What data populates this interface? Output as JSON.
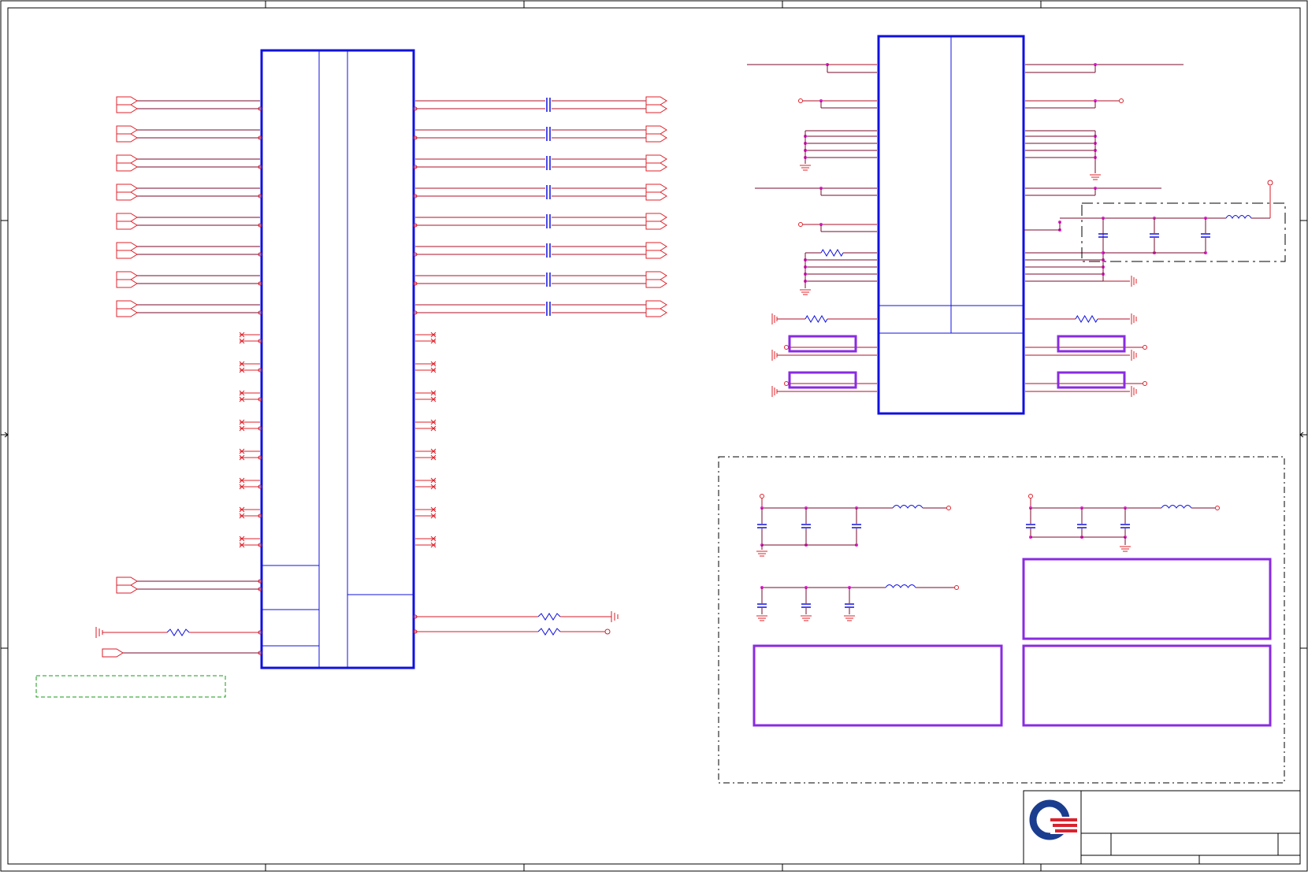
{
  "sheet": {
    "colors": {
      "border": "#000000",
      "wire": "#b0102a",
      "wire_dark": "#7a0b2e",
      "pin": "#e0202a",
      "component": "#1010e0",
      "capacitor": "#1010e0",
      "junction": "#e020d0",
      "highlight_box": "#8a2be2",
      "note_box": "#1a9a1a",
      "dash_box": "#000000"
    },
    "left_chip": {
      "input_port_count": 8,
      "output_port_count": 8,
      "nc_pin_rows": 8
    },
    "right_chip": {
      "has_filter_inset": true
    },
    "power_filter_panel": {
      "purple_note_boxes": 3
    },
    "title_block": {
      "logo_name": "quanta-logo",
      "logo_colors": {
        "blue": "#1a3d8f",
        "red": "#d9232e"
      }
    }
  }
}
